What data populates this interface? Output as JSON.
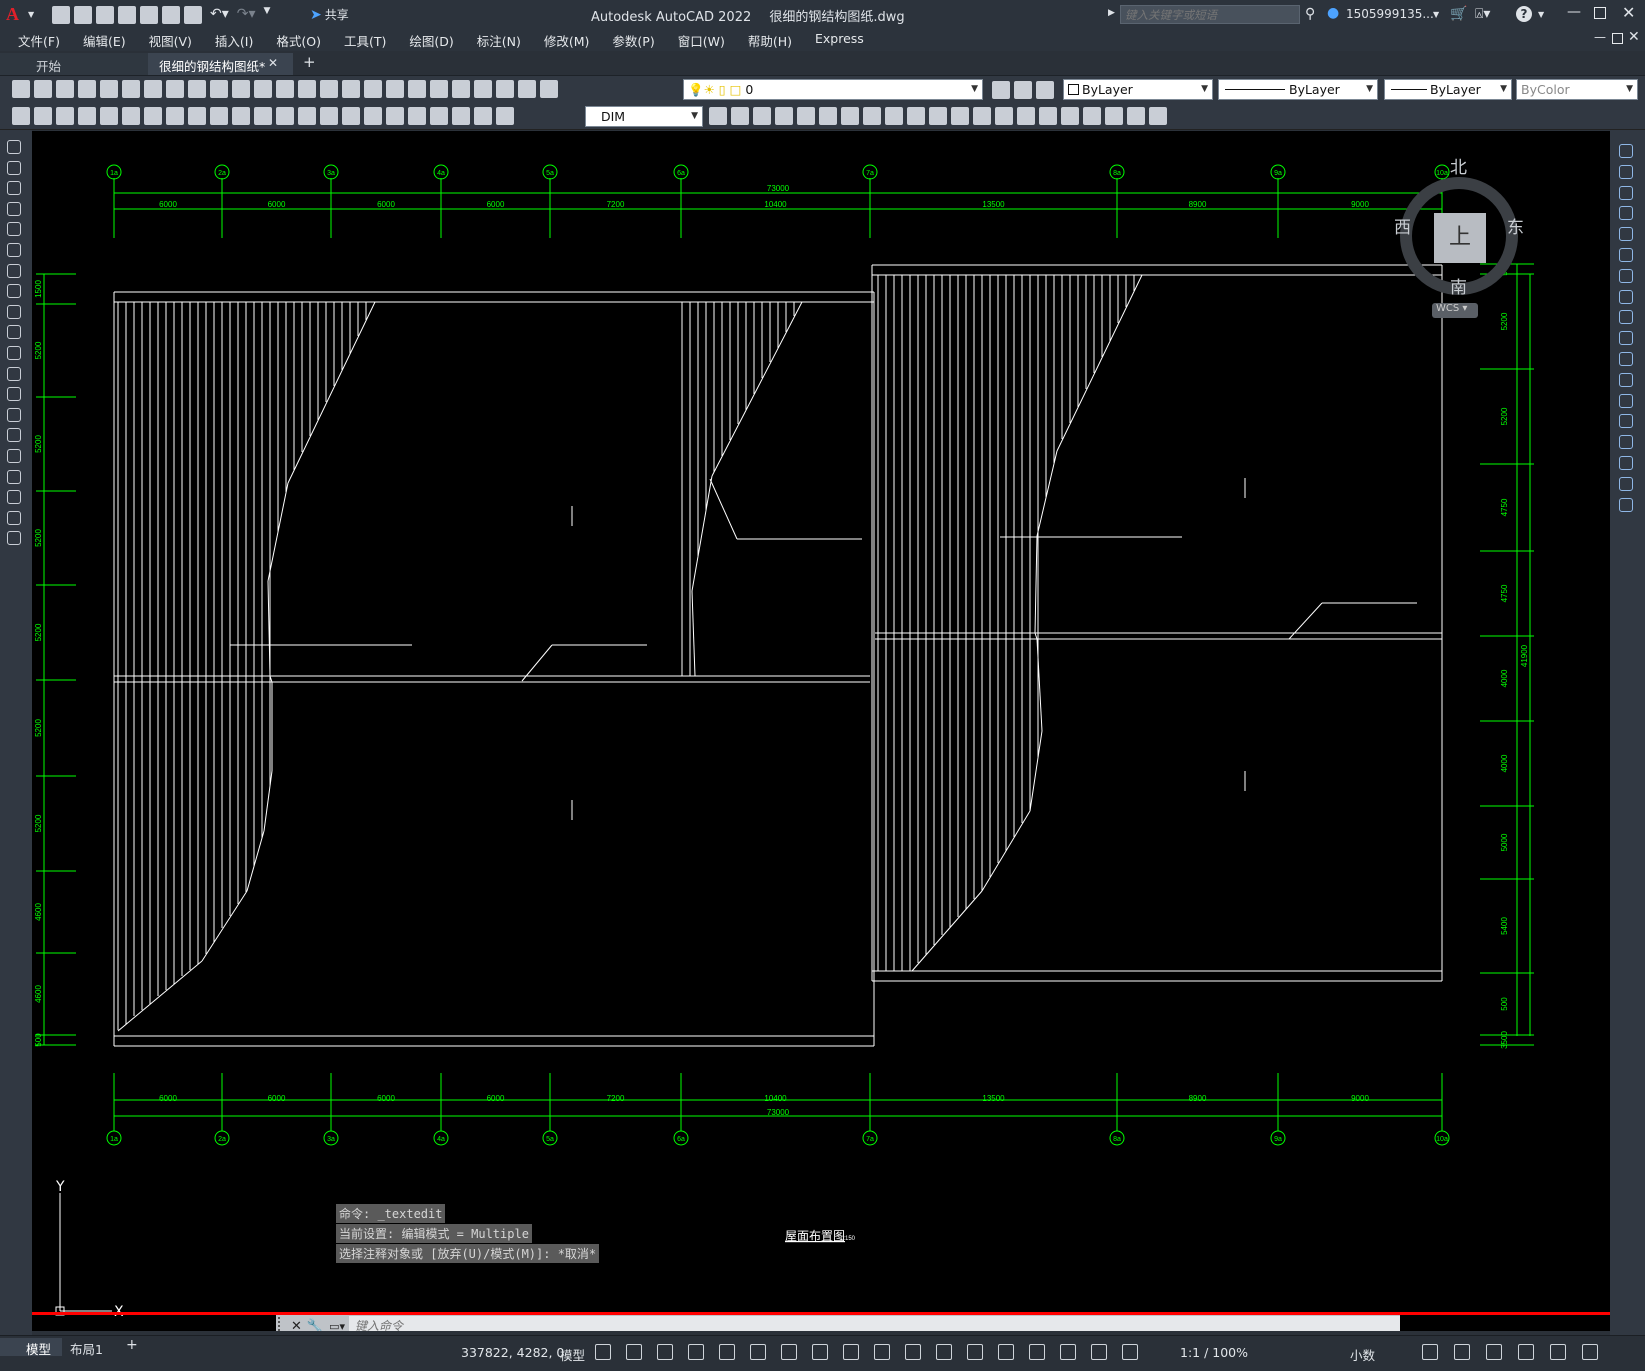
{
  "title_bar": {
    "app_name": "Autodesk AutoCAD 2022",
    "file_name": "很细的钢结构图纸.dwg",
    "share_label": "共享",
    "search_placeholder": "键入关键字或短语",
    "user": "1505999135..."
  },
  "menu": [
    "文件(F)",
    "编辑(E)",
    "视图(V)",
    "插入(I)",
    "格式(O)",
    "工具(T)",
    "绘图(D)",
    "标注(N)",
    "修改(M)",
    "参数(P)",
    "窗口(W)",
    "帮助(H)",
    "Express"
  ],
  "tabs": [
    {
      "label": "开始"
    },
    {
      "label": "很细的钢结构图纸*"
    }
  ],
  "toolbar": {
    "layer_value": "0",
    "color_value": "ByLayer",
    "linetype_value": "ByLayer",
    "lineweight_value": "ByLayer",
    "plotstyle_value": "ByColor",
    "dimstyle_value": "DIM"
  },
  "viewcube": {
    "north": "北",
    "south": "南",
    "east": "东",
    "west": "西",
    "top": "上",
    "wcs": "WCS"
  },
  "drawing": {
    "grid_top_labels": [
      "1a",
      "2a",
      "3a",
      "4a",
      "5a",
      "6a",
      "7a",
      "8a",
      "9a",
      "10a"
    ],
    "total_dim": "73000",
    "bay_dims": [
      "6000",
      "6000",
      "6000",
      "6000",
      "7200",
      "10400",
      "13500",
      "8900",
      "9000"
    ],
    "left_dims": [
      "1500",
      "5200",
      "5200",
      "5200",
      "5200",
      "5200",
      "5200",
      "4600",
      "4600",
      "500"
    ],
    "right_dims": [
      "500",
      "5200",
      "5200",
      "4750",
      "4750",
      "4000",
      "4000",
      "5000",
      "5400",
      "500",
      "3500"
    ],
    "right_total": "41900",
    "drawing_title": "屋面布置图",
    "scale_note": "1:150",
    "ucs_y": "Y",
    "ucs_x": "X"
  },
  "command": {
    "history": [
      "命令: _textedit",
      "当前设置: 编辑模式 = Multiple",
      "选择注释对象或 [放弃(U)/模式(M)]: *取消*"
    ],
    "placeholder": "键入命令"
  },
  "status": {
    "layout_tabs": [
      "模型",
      "布局1"
    ],
    "coords": "337822, 4282, 0",
    "model_label": "模型",
    "scale": "1:1 / 100%",
    "units": "小数"
  },
  "colors": {
    "canvas": "#000000",
    "grid_green": "#00ff00",
    "line_white": "#ffffff",
    "command_red": "#ff0000",
    "ui_dark": "#2c333c"
  }
}
